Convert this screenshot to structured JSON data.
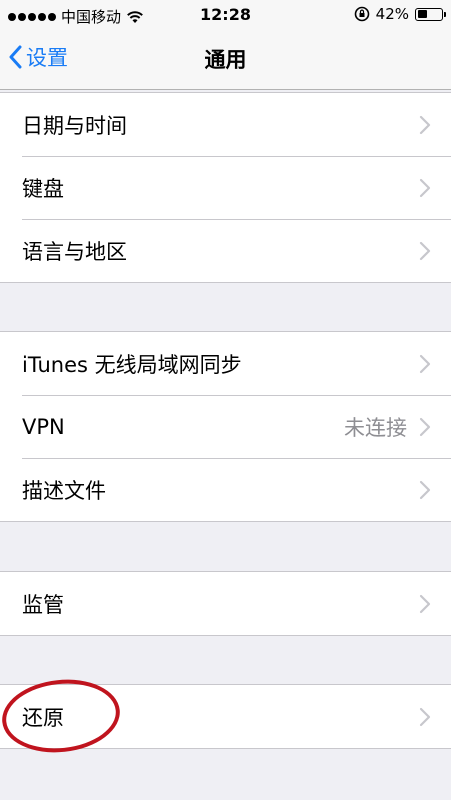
{
  "status_bar": {
    "carrier": "中国移动",
    "time": "12:28",
    "battery_percent": "42%",
    "battery_level": 0.42
  },
  "nav": {
    "back_label": "设置",
    "title": "通用"
  },
  "groups": [
    {
      "rows": [
        {
          "label": "日期与时间"
        },
        {
          "label": "键盘"
        },
        {
          "label": "语言与地区"
        }
      ]
    },
    {
      "rows": [
        {
          "label": "iTunes 无线局域网同步"
        },
        {
          "label": "VPN",
          "value": "未连接"
        },
        {
          "label": "描述文件"
        }
      ]
    },
    {
      "rows": [
        {
          "label": "监管"
        }
      ]
    },
    {
      "rows": [
        {
          "label": "还原"
        }
      ]
    }
  ],
  "colors": {
    "accent": "#1a7cf5",
    "background": "#efeff4",
    "annotation": "#c0141e"
  },
  "icons": [
    "wifi-icon",
    "orientation-lock-icon",
    "battery-icon",
    "chevron-left-icon",
    "chevron-right-icon"
  ]
}
